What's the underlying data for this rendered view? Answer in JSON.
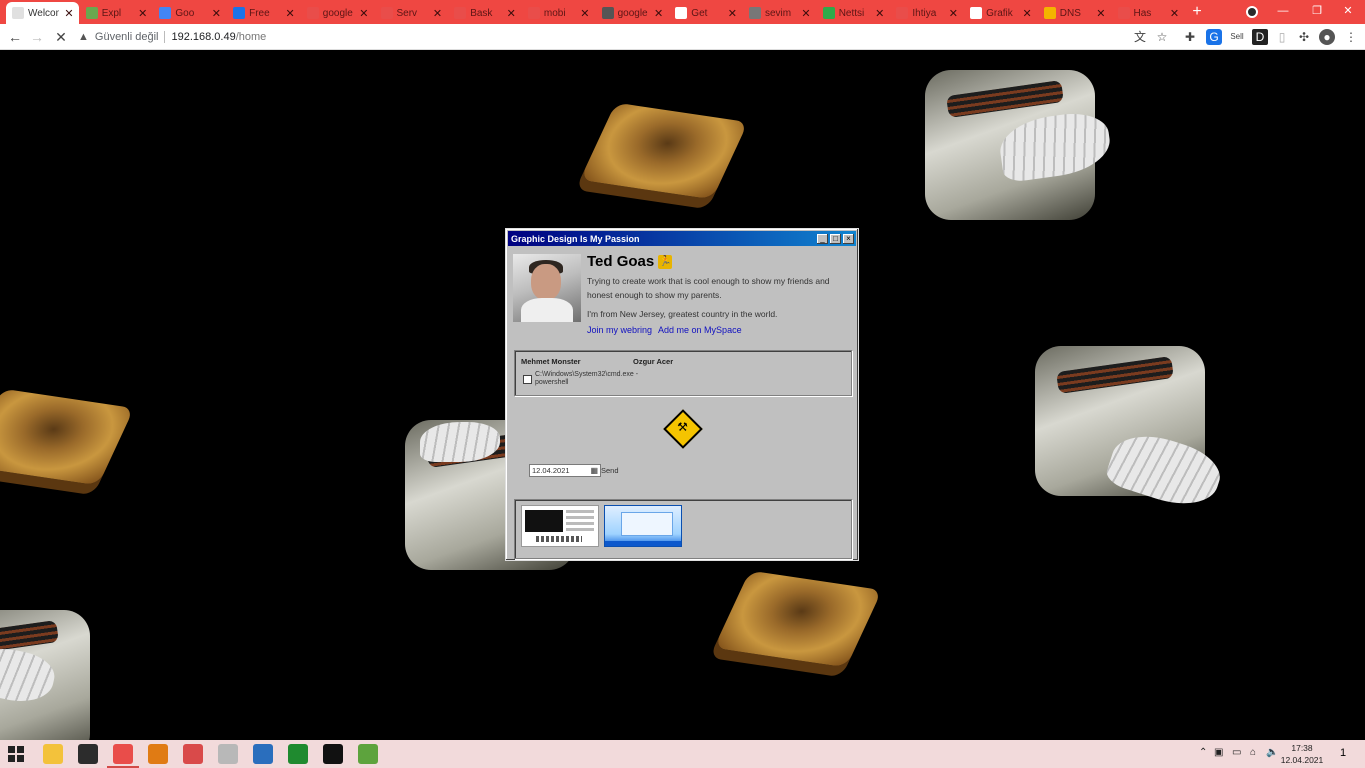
{
  "browser": {
    "tabs": [
      {
        "title": "Welcom",
        "favicon_color": "#e0e0e0",
        "active": true
      },
      {
        "title": "Expl",
        "favicon_color": "#6aa84f"
      },
      {
        "title": "Goo",
        "favicon_color": "#4285f4"
      },
      {
        "title": "Free",
        "favicon_color": "#1a73e8"
      },
      {
        "title": "google",
        "favicon_color": "#e94d4a"
      },
      {
        "title": "Serv",
        "favicon_color": "#e94d4a"
      },
      {
        "title": "Bask",
        "favicon_color": "#e94d4a"
      },
      {
        "title": "mobi",
        "favicon_color": "#e94d4a"
      },
      {
        "title": "google",
        "favicon_color": "#555555"
      },
      {
        "title": "Get",
        "favicon_color": "#ffffff"
      },
      {
        "title": "sevim",
        "favicon_color": "#777777"
      },
      {
        "title": "Nettsi",
        "favicon_color": "#2eaa4a"
      },
      {
        "title": "Ihtiya",
        "favicon_color": "#e94d4a"
      },
      {
        "title": "Grafik",
        "favicon_color": "#ffffff"
      },
      {
        "title": "DNS",
        "favicon_color": "#f4b400"
      },
      {
        "title": "Has",
        "favicon_color": "#e94d4a"
      }
    ],
    "window_controls": {
      "minimize": "—",
      "maximize": "❐",
      "close": "✕"
    },
    "address": {
      "security_label": "Güvenli değil",
      "host": "192.168.0.49",
      "path": "/home"
    },
    "profile_label": "Sell"
  },
  "retro_window": {
    "title": "Graphic Design Is My Passion",
    "controls": {
      "minimize": "_",
      "maximize": "□",
      "close": "×"
    },
    "profile": {
      "name": "Ted Goas",
      "bio_line1": "Trying to create work that is cool enough to show my friends and honest enough to show my parents.",
      "bio_line2": "I'm from New Jersey, greatest country in the world.",
      "link_webring": "Join my webring",
      "link_myspace": "Add me on MySpace"
    },
    "panel1": {
      "col1": "Mehmet Monster",
      "col2": "Ozgur Acer",
      "file_path": "C:\\Windows\\System32\\cmd.exe - powershell"
    },
    "date_value": "12.04.2021",
    "send_label": "Send"
  },
  "taskbar": {
    "time": "17:38",
    "date": "12.04.2021",
    "notifications_count": "1",
    "apps": [
      {
        "name": "file-explorer",
        "color": "#f3c23b"
      },
      {
        "name": "terminal",
        "color": "#2c2c2c"
      },
      {
        "name": "chrome",
        "color": "#e94d4a",
        "active": true
      },
      {
        "name": "sublime-text",
        "color": "#e07b14"
      },
      {
        "name": "outlook",
        "color": "#d94a4a"
      },
      {
        "name": "drive",
        "color": "#b8b8b8"
      },
      {
        "name": "powershell",
        "color": "#2a6ebd"
      },
      {
        "name": "xbox",
        "color": "#1f8a2f"
      },
      {
        "name": "cmd",
        "color": "#111111"
      },
      {
        "name": "notepad",
        "color": "#5da33d"
      }
    ]
  }
}
